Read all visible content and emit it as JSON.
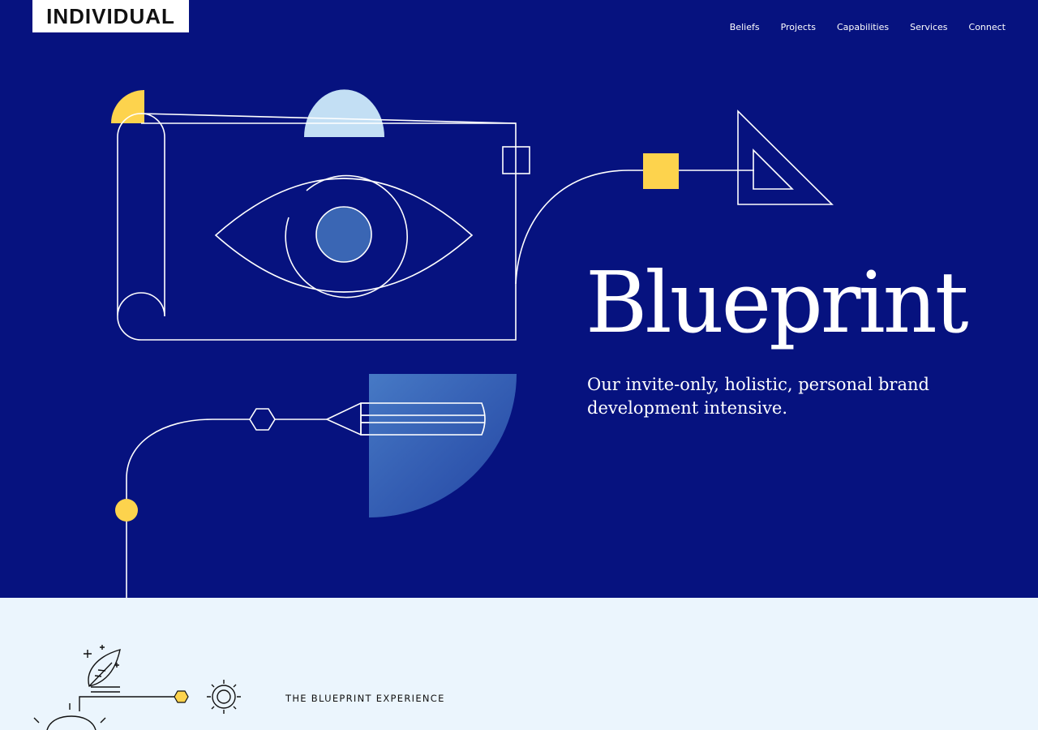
{
  "header": {
    "logo_text": "INDIVIDUAL",
    "nav": [
      {
        "label": "Beliefs"
      },
      {
        "label": "Projects"
      },
      {
        "label": "Capabilities"
      },
      {
        "label": "Services"
      },
      {
        "label": "Connect"
      }
    ]
  },
  "hero": {
    "title": "Blueprint",
    "subtitle": "Our invite-only, holistic, personal brand development intensive."
  },
  "section": {
    "label": "THE BLUEPRINT EXPERIENCE"
  },
  "colors": {
    "hero_bg": "#06127f",
    "accent_yellow": "#fdd34d",
    "light_blue": "#c3dff4",
    "section_bg": "#ebf5fd"
  },
  "icons": [
    "eye-icon",
    "triangle-ruler-icon",
    "pen-nib-icon",
    "quill-icon",
    "gear-icon",
    "lightbulb-icon"
  ]
}
